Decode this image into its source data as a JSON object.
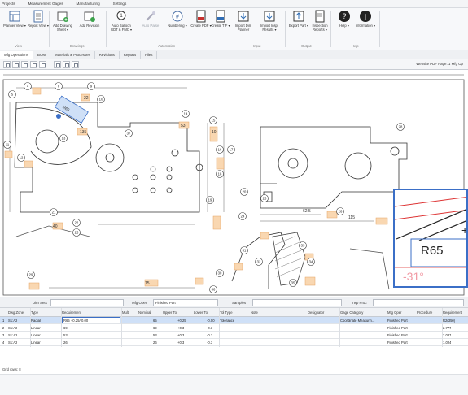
{
  "menu": [
    "Projects",
    "Measurement Gages",
    "Manufacturing",
    "Settings"
  ],
  "ribbon": {
    "buttons": [
      {
        "label": "Planner View ▾",
        "icon": "planner-icon"
      },
      {
        "label": "Report View ▾",
        "icon": "report-icon"
      },
      {
        "label": "Add Drawing Sheet ▾",
        "icon": "add-drawing-icon"
      },
      {
        "label": "Add Revision",
        "icon": "add-revision-icon"
      },
      {
        "label": "Auto Balloon GDT & FMC ▾",
        "icon": "balloon-icon"
      },
      {
        "label": "Auto Parse",
        "icon": "wand-icon"
      },
      {
        "label": "Numbering ▾",
        "icon": "numbering-icon"
      },
      {
        "label": "Create PDF ▾",
        "icon": "pdf-icon"
      },
      {
        "label": "Create TIF ▾",
        "icon": "tif-icon"
      },
      {
        "label": "Import Dim Planner",
        "icon": "import-planner-icon"
      },
      {
        "label": "Import Insp. Results ▾",
        "icon": "import-results-icon"
      },
      {
        "label": "Export Part ▾",
        "icon": "export-icon"
      },
      {
        "label": "Inspection Reports ▾",
        "icon": "inspection-icon"
      },
      {
        "label": "Help ▾",
        "icon": "help-icon"
      },
      {
        "label": "Information ▾",
        "icon": "info-icon"
      }
    ],
    "groups": [
      "View",
      "Drawings",
      "Automation",
      "Input",
      "Output",
      "Help"
    ]
  },
  "tabs": [
    "Mfg Operations",
    "BOM",
    "Materials & Processes",
    "Revisions",
    "Reports",
    "Files"
  ],
  "toolbar": {
    "pdf_page": "Website PDF Page: 1 Mfg Op"
  },
  "drawing": {
    "balloons": [
      "4",
      "5",
      "8",
      "9",
      "10",
      "11",
      "12",
      "13",
      "14",
      "15",
      "16",
      "17",
      "18",
      "19",
      "20",
      "21",
      "22",
      "23",
      "24",
      "25",
      "26",
      "27",
      "28",
      "29",
      "30",
      "31",
      "32",
      "33",
      "34",
      "35",
      "36",
      "37"
    ],
    "dim_texts": [
      "R65",
      "62.5",
      "115",
      "15",
      "135",
      "10",
      "53",
      "40",
      "22"
    ],
    "zoom": {
      "radius": "R65",
      "angle": "-31°"
    }
  },
  "grid": {
    "filters": {
      "dim_sets_label": "Dim Sets",
      "mfg_oper_label": "Mfg Oper",
      "mfg_oper_value": "Finished Part",
      "samples_label": "Samples",
      "insp_proc_label": "Insp Proc"
    },
    "columns": [
      "",
      "Dwg Zone",
      "Type",
      "Requirement",
      "Mult",
      "Nominal",
      "Upper Tol",
      "Lower Tol",
      "Tol Type",
      "Note",
      "Designator",
      "Gage Category",
      "Mfg Oper",
      "Procedure",
      "Requirement"
    ],
    "rows": [
      [
        "1",
        "S1:A2",
        "Radial",
        "R65 +0.25/-0.00",
        "",
        "65",
        "+0.25",
        "-0.00",
        "Tolerance",
        "",
        "",
        "Coordinate Measurin...",
        "Finished Part",
        "",
        "R2(350)"
      ],
      [
        "2",
        "S1:A2",
        "Linear",
        "69",
        "",
        "69",
        "+0.3",
        "-0.3",
        "",
        "",
        "",
        "",
        "Finished Part",
        "",
        "2.777"
      ],
      [
        "3",
        "S1:A2",
        "Linear",
        "53",
        "",
        "53",
        "+0.3",
        "-0.3",
        "",
        "",
        "",
        "",
        "Finished Part",
        "",
        "2.087"
      ],
      [
        "4",
        "S1:A2",
        "Linear",
        "26",
        "",
        "26",
        "+0.3",
        "-0.3",
        "",
        "",
        "",
        "",
        "Finished Part",
        "",
        "1.024"
      ]
    ],
    "status": "Grid rows: 8"
  }
}
